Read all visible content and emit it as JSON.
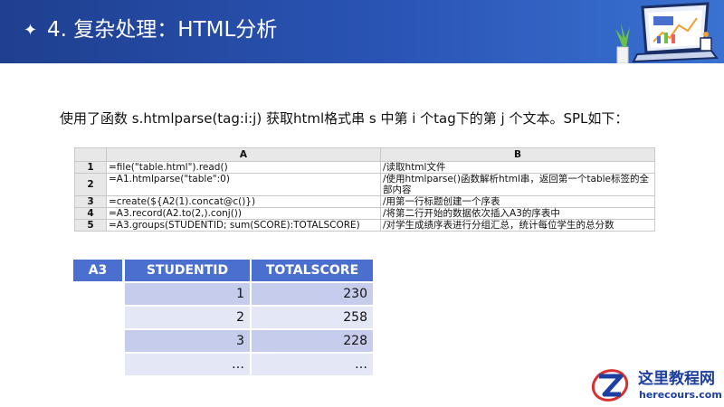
{
  "slide": {
    "title": "4. 复杂处理：HTML分析",
    "intro": "使用了函数 s.htmlparse(tag:i:j) 获取html格式串 s 中第 i 个tag下的第 j 个文本。SPL如下："
  },
  "code_table": {
    "columns": [
      "A",
      "B"
    ],
    "rows": [
      {
        "num": "1",
        "a": "=file(\"table.html\").read()",
        "b": "/读取html文件"
      },
      {
        "num": "2",
        "a": "=A1.htmlparse(\"table\":0)",
        "b": "/使用htmlparse()函数解析html串，返回第一个table标签的全部内容"
      },
      {
        "num": "3",
        "a": "=create(${A2(1).concat@c()})",
        "b": "/用第一行标题创建一个序表"
      },
      {
        "num": "4",
        "a": "=A3.record(A2.to(2,).conj())",
        "b": "/将第二行开始的数据依次插入A3的序表中"
      },
      {
        "num": "5",
        "a": "=A3.groups(STUDENTID; sum(SCORE):TOTALSCORE)",
        "b": "/对学生成绩序表进行分组汇总，统计每位学生的总分数"
      }
    ]
  },
  "result_table": {
    "corner": "A3",
    "headers": [
      "STUDENTID",
      "TOTALSCORE"
    ],
    "rows": [
      [
        "1",
        "230"
      ],
      [
        "2",
        "258"
      ],
      [
        "3",
        "228"
      ],
      [
        "…",
        "…"
      ]
    ]
  },
  "branding": {
    "name": "这里教程网",
    "url": "herecours.com"
  },
  "colors": {
    "header_blue": "#2a55b6",
    "table_header": "#4a6fcf",
    "row_dark": "#c6cdec",
    "row_light": "#e4e7f5"
  }
}
